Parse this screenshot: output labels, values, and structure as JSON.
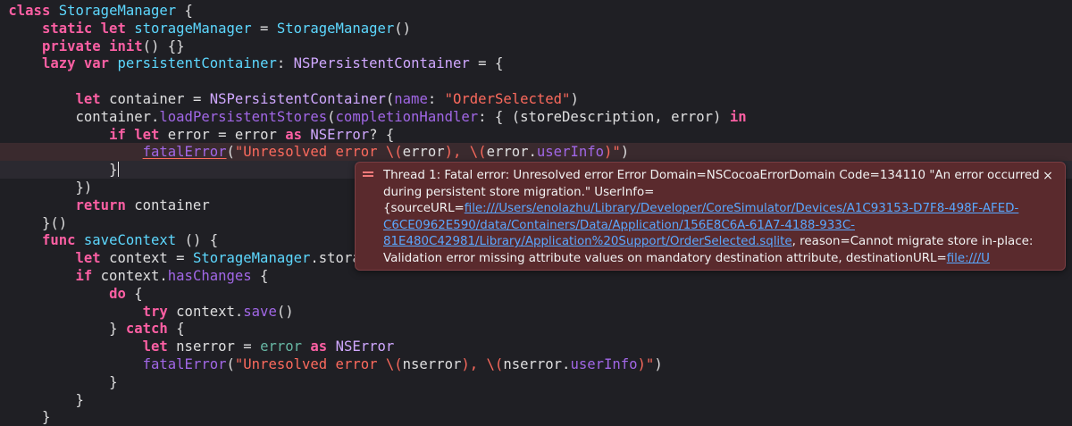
{
  "code_lines": [
    {
      "indent": 0,
      "tokens": [
        [
          "class ",
          "k"
        ],
        [
          "StorageManager",
          "t"
        ],
        [
          " {",
          "p"
        ]
      ]
    },
    {
      "indent": 1,
      "tokens": [
        [
          "static ",
          "k"
        ],
        [
          "let ",
          "k"
        ],
        [
          "storageManager",
          "t"
        ],
        [
          " = ",
          "p"
        ],
        [
          "StorageManager",
          "t"
        ],
        [
          "()",
          "p"
        ]
      ]
    },
    {
      "indent": 1,
      "tokens": [
        [
          "private ",
          "k"
        ],
        [
          "init",
          "k"
        ],
        [
          "() {}",
          "p"
        ]
      ]
    },
    {
      "indent": 1,
      "tokens": [
        [
          "lazy ",
          "k"
        ],
        [
          "var ",
          "k"
        ],
        [
          "persistentContainer",
          "t"
        ],
        [
          ": ",
          "p"
        ],
        [
          "NSPersistentContainer",
          "tp"
        ],
        [
          " = {",
          "p"
        ]
      ]
    },
    {
      "indent": 0,
      "tokens": []
    },
    {
      "indent": 2,
      "tokens": [
        [
          "let ",
          "k"
        ],
        [
          "container",
          "p"
        ],
        [
          " = ",
          "p"
        ],
        [
          "NSPersistentContainer",
          "tp"
        ],
        [
          "(",
          "p"
        ],
        [
          "name",
          "m"
        ],
        [
          ": ",
          "p"
        ],
        [
          "\"OrderSelected\"",
          "s"
        ],
        [
          ")",
          "p"
        ]
      ]
    },
    {
      "indent": 2,
      "tokens": [
        [
          "container.",
          "p"
        ],
        [
          "loadPersistentStores",
          "m"
        ],
        [
          "(",
          "p"
        ],
        [
          "completionHandler",
          "m"
        ],
        [
          ": { (storeDescription, error) ",
          "p"
        ],
        [
          "in",
          "k"
        ]
      ]
    },
    {
      "indent": 3,
      "tokens": [
        [
          "if ",
          "k"
        ],
        [
          "let ",
          "k"
        ],
        [
          "error = error ",
          "p"
        ],
        [
          "as ",
          "k"
        ],
        [
          "NSError",
          "tp"
        ],
        [
          "? {",
          "p"
        ]
      ]
    },
    {
      "indent": 4,
      "tokens": [
        [
          "fatalError",
          "u"
        ],
        [
          "(",
          "p"
        ],
        [
          "\"Unresolved error \\(",
          "s"
        ],
        [
          "error",
          "p"
        ],
        [
          "), \\(",
          "s"
        ],
        [
          "error.",
          "p"
        ],
        [
          "userInfo",
          "m"
        ],
        [
          ")\"",
          "s"
        ],
        [
          ")",
          "p"
        ]
      ]
    },
    {
      "indent": 3,
      "tokens": [
        [
          "}",
          "p"
        ]
      ],
      "cursor": true
    },
    {
      "indent": 2,
      "tokens": [
        [
          "})",
          "p"
        ]
      ]
    },
    {
      "indent": 2,
      "tokens": [
        [
          "return ",
          "k"
        ],
        [
          "container",
          "p"
        ]
      ]
    },
    {
      "indent": 1,
      "tokens": [
        [
          "}()",
          "p"
        ]
      ]
    },
    {
      "indent": 1,
      "tokens": [
        [
          "func ",
          "k"
        ],
        [
          "saveContext",
          "t"
        ],
        [
          " () {",
          "p"
        ]
      ]
    },
    {
      "indent": 2,
      "tokens": [
        [
          "let ",
          "k"
        ],
        [
          "context = ",
          "p"
        ],
        [
          "StorageManager",
          "t"
        ],
        [
          ".stora",
          "p"
        ]
      ]
    },
    {
      "indent": 2,
      "tokens": [
        [
          "if ",
          "k"
        ],
        [
          "context.",
          "p"
        ],
        [
          "hasChanges",
          "m"
        ],
        [
          " {",
          "p"
        ]
      ]
    },
    {
      "indent": 3,
      "tokens": [
        [
          "do ",
          "k"
        ],
        [
          "{",
          "p"
        ]
      ]
    },
    {
      "indent": 4,
      "tokens": [
        [
          "try ",
          "k"
        ],
        [
          "context.",
          "p"
        ],
        [
          "save",
          "m"
        ],
        [
          "()",
          "p"
        ]
      ]
    },
    {
      "indent": 3,
      "tokens": [
        [
          "} ",
          "p"
        ],
        [
          "catch ",
          "k"
        ],
        [
          "{",
          "p"
        ]
      ]
    },
    {
      "indent": 4,
      "tokens": [
        [
          "let ",
          "k"
        ],
        [
          "nserror = ",
          "p"
        ],
        [
          "error ",
          "pl"
        ],
        [
          "as ",
          "k"
        ],
        [
          "NSError",
          "tp"
        ]
      ]
    },
    {
      "indent": 4,
      "tokens": [
        [
          "fatalError",
          "m"
        ],
        [
          "(",
          "p"
        ],
        [
          "\"Unresolved error \\(",
          "s"
        ],
        [
          "nserror",
          "p"
        ],
        [
          "), \\(",
          "s"
        ],
        [
          "nserror.",
          "p"
        ],
        [
          "userInfo",
          "m"
        ],
        [
          ")\"",
          "s"
        ],
        [
          ")",
          "p"
        ]
      ]
    },
    {
      "indent": 3,
      "tokens": [
        [
          "}",
          "p"
        ]
      ]
    },
    {
      "indent": 2,
      "tokens": [
        [
          "}",
          "p"
        ]
      ]
    },
    {
      "indent": 1,
      "tokens": [
        [
          "}",
          "p"
        ]
      ]
    }
  ],
  "error": {
    "parts": [
      {
        "text": "Thread 1: Fatal error: Unresolved error Error Domain=NSCocoaErrorDomain Code=134110 \"An error occurred during persistent store migration.\" UserInfo={sourceURL=",
        "link": false
      },
      {
        "text": "file:///Users/enolazhu/Library/Developer/CoreSimulator/Devices/A1C93153-D7F8-498F-AFED-C6CE0962E590/data/Containers/Data/Application/156E8C6A-61A7-4188-933C-81E480C42981/Library/Application%20Support/OrderSelected.sqlite",
        "link": true
      },
      {
        "text": ", reason=Cannot migrate store in-place: Validation error missing attribute values on mandatory destination attribute, destinationURL=",
        "link": false
      },
      {
        "text": "file:///U",
        "link": true
      }
    ],
    "close_label": "×"
  },
  "colors": {
    "background": "#1f1f24",
    "keyword": "#fc5fa3",
    "type": "#5dd8ff",
    "string": "#fc6a5d",
    "method": "#a167e6",
    "error_background": "#5a2a2d",
    "link": "#5aa8ff"
  }
}
